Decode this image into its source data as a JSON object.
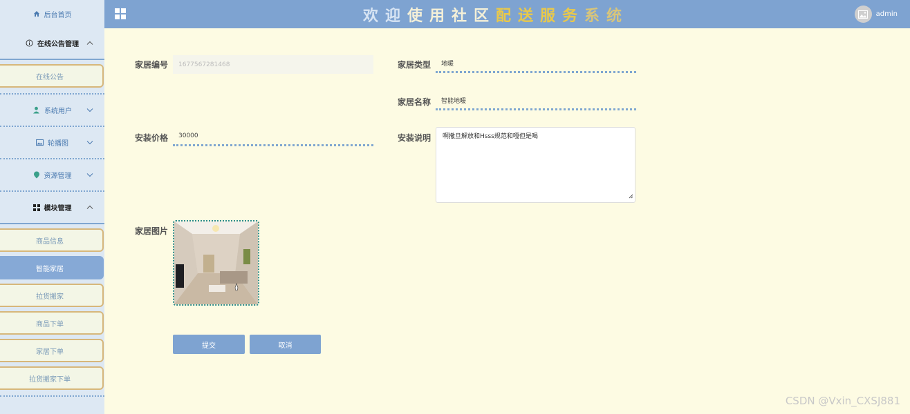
{
  "header": {
    "title_parts": [
      "欢迎",
      "使用社区",
      "配送服务",
      "系统"
    ],
    "user": "admin"
  },
  "sidebar": {
    "home": "后台首页",
    "groups": [
      {
        "label": "在线公告管理",
        "items": [
          "在线公告"
        ]
      },
      {
        "label": "系统用户"
      },
      {
        "label": "轮播图"
      },
      {
        "label": "资源管理"
      },
      {
        "label": "模块管理",
        "items": [
          "商品信息",
          "智能家居",
          "拉货搬家",
          "商品下单",
          "家居下单",
          "拉货搬家下单"
        ]
      }
    ]
  },
  "form": {
    "home_no_label": "家居编号",
    "home_no_value": "1677567281468",
    "home_type_label": "家居类型",
    "home_type_value": "地暖",
    "home_name_label": "家居名称",
    "home_name_value": "智能地暖",
    "price_label": "安装价格",
    "price_value": "30000",
    "desc_label": "安装说明",
    "desc_value": "啊撒旦解放和Hsss规范和嘎但是喝",
    "image_label": "家居图片",
    "submit": "提交",
    "cancel": "取消"
  },
  "watermark": "CSDN @Vxin_CXSJ881",
  "colors": {
    "accent": "#7ea3d1",
    "background": "#fdfbe3",
    "sidebar": "#dde8f3",
    "title_gold": "#e8c84c"
  }
}
